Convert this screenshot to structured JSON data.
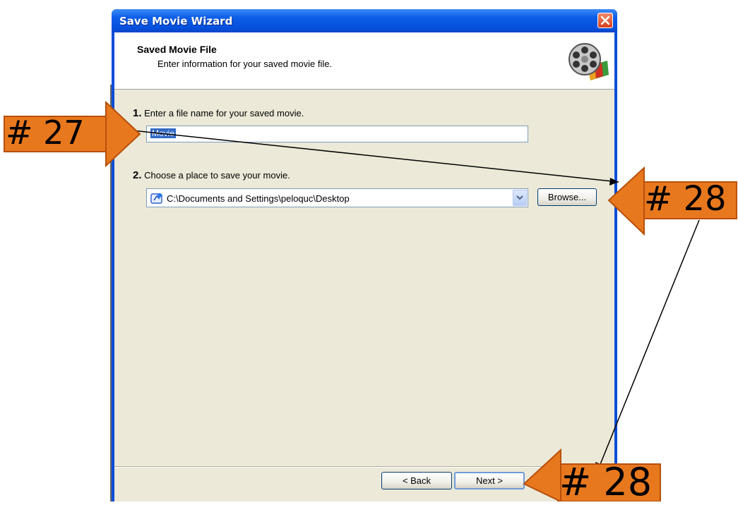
{
  "window": {
    "title": "Save Movie Wizard",
    "header_title": "Saved Movie File",
    "header_subtitle": "Enter information for your saved movie file."
  },
  "step1": {
    "number": "1.",
    "label": "Enter a file name for your saved movie.",
    "filename_value": "Movie"
  },
  "step2": {
    "number": "2.",
    "label": "Choose a place to save your movie.",
    "location_value": "C:\\Documents and Settings\\peloquc\\Desktop",
    "browse_label": "Browse..."
  },
  "footer": {
    "back_label": "< Back",
    "next_label": "Next >"
  },
  "annotations": {
    "label_27": "# 27",
    "label_28_top": "# 28",
    "label_28_bottom": "# 28"
  },
  "colors": {
    "title_bar": "#0550dc",
    "dialog_face": "#ece9d8",
    "callout_orange": "#e8781e",
    "selection": "#316ac5"
  },
  "icons": [
    "close-icon",
    "film-reel-icon",
    "folder-location-icon",
    "chevron-down-icon",
    "orange-arrow-icon"
  ]
}
